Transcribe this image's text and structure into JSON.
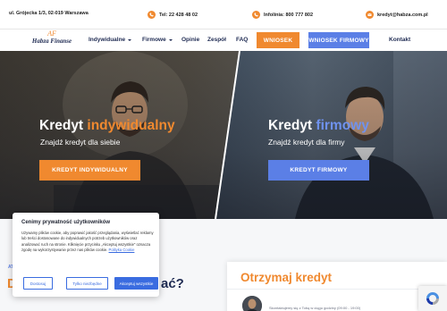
{
  "topbar": {
    "address": "ul. Grójecka 1/3, 02-019 Warszawa",
    "phone": "Tel: 22 428 48 02",
    "hotline": "Infolinia: 800 777 802",
    "email": "kredyt@habza.com.pl"
  },
  "nav": {
    "logo_monogram": "AF",
    "logo_name": "Habza Finanse",
    "items": [
      "Indywidualne",
      "Firmowe",
      "Opinie",
      "Zespół",
      "FAQ"
    ],
    "wniosek": "WNIOSEK",
    "wniosek_firmowy": "WNIOSEK FIRMOWY",
    "kontakt": "Kontakt"
  },
  "hero": {
    "left": {
      "title_plain": "Kredyt ",
      "title_accent": "indywidualny",
      "subtitle": "Znajdź kredyt dla siebie",
      "button": "KREDYT INDYWIDUALNY"
    },
    "right": {
      "title_plain": "Kredyt ",
      "title_accent": "firmowy",
      "subtitle": "Znajdź kredyt dla firmy",
      "button": "KREDYT FIRMOWY"
    }
  },
  "lower": {
    "small_label": "AT",
    "heading_left": "D",
    "heading_right": "ać?",
    "card_title": "Otrzymaj kredyt",
    "card_hours": "Skontaktujemy się z Tobą w ciągu godziny (09:00 - 19:00)"
  },
  "cookie": {
    "title": "Cenimy prywatność użytkowników",
    "body": "Używamy plików cookie, aby poprawić jakość przeglądania, wyświetlać reklamy lub treści dostosowane do indywidualnych potrzeb użytkowników oraz analizować ruch na stronie. Kliknięcie przycisku „Akceptuj wszystkie\" oznacza zgodę na wykorzystywanie przez nas plików cookie.",
    "policy_link": "Polityka Cookie",
    "btn_customize": "Dostosuj",
    "btn_reject": "Tylko niezbędne",
    "btn_accept": "Akceptuj wszystkie"
  },
  "colors": {
    "orange": "#f0892f",
    "blue": "#5b7fe6",
    "navy": "#1e2a52"
  }
}
